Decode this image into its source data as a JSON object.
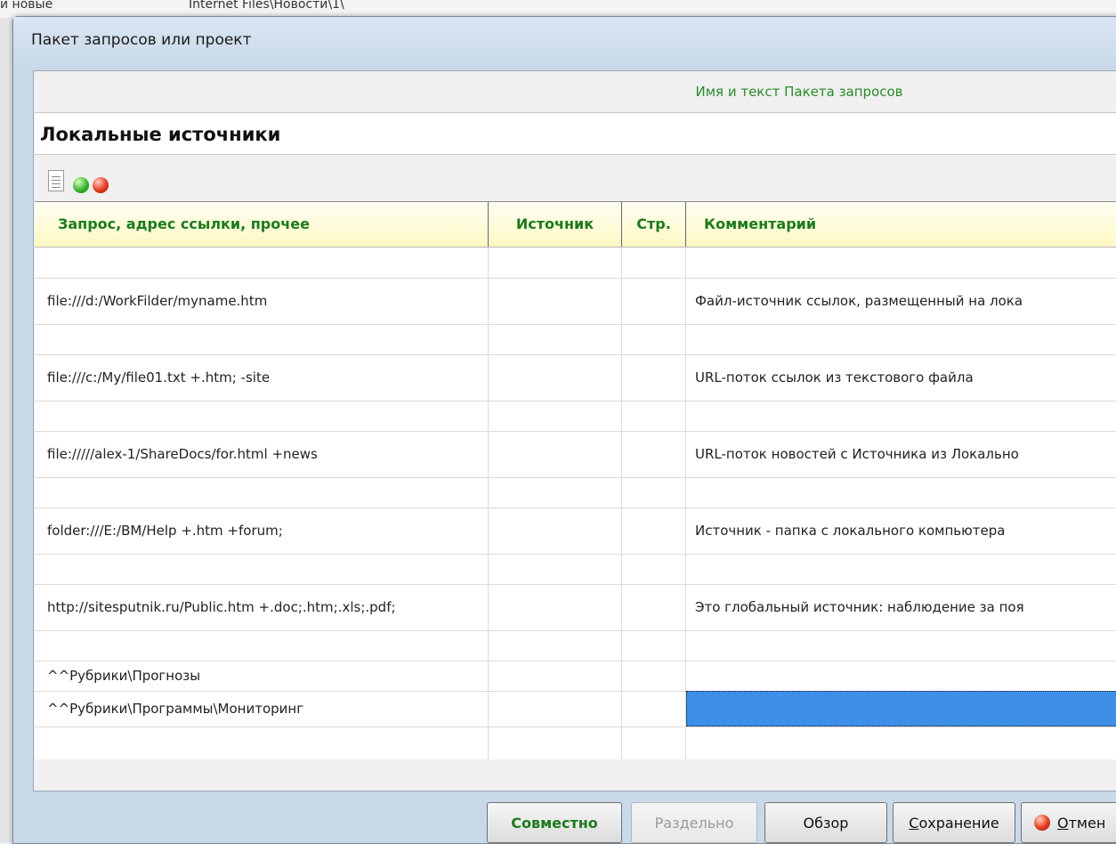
{
  "background": {
    "left_text": "и новые",
    "right_text": "Internet Files\\Новости\\1\\"
  },
  "window": {
    "title": "Пакет запросов или проект"
  },
  "group": {
    "caption": "Имя и текст Пакета запросов"
  },
  "package": {
    "name": "Локальные источники"
  },
  "toolbar": {
    "icons": [
      "document-icon",
      "green-ball-icon",
      "red-ball-icon"
    ]
  },
  "table": {
    "headers": [
      "Запрос, адрес ссылки, прочее",
      "Источник",
      "Стр.",
      "Комментарий"
    ],
    "rows": [
      [
        "",
        "",
        "",
        ""
      ],
      [
        "file:///d:/WorkFilder/myname.htm",
        "",
        "",
        "Файл-источник ссылок, размещенный на лока"
      ],
      [
        "",
        "",
        "",
        ""
      ],
      [
        "file:///c:/My/file01.txt +.htm; -site",
        "",
        "",
        "URL-поток ссылок из текстового файла"
      ],
      [
        "",
        "",
        "",
        ""
      ],
      [
        "file://///alex-1/ShareDocs/for.html +news",
        "",
        "",
        "URL-поток новостей с Источника из Локально"
      ],
      [
        "",
        "",
        "",
        ""
      ],
      [
        "folder:///E:/BM/Help +.htm +forum;",
        "",
        "",
        "Источник - папка с локального компьютера"
      ],
      [
        "",
        "",
        "",
        ""
      ],
      [
        "http://sitesputnik.ru/Public.htm +.doc;.htm;.xls;.pdf;",
        "",
        "",
        "Это глобальный источник: наблюдение за поя"
      ],
      [
        "",
        "",
        "",
        ""
      ],
      [
        "^^Рубрики\\Прогнозы",
        "",
        "",
        ""
      ],
      [
        "^^Рубрики\\Программы\\Мониторинг",
        "",
        "",
        ""
      ],
      [
        "",
        "",
        "",
        ""
      ],
      [
        "",
        "",
        "",
        ""
      ],
      [
        "",
        "",
        "",
        ""
      ]
    ],
    "selected": {
      "row": 12,
      "col": 3,
      "color": "#3d8fe8"
    }
  },
  "buttons": {
    "together": "Совместно",
    "separate": "Раздельно",
    "browse": "Обзор",
    "save_first": "С",
    "save_rest": "охранение",
    "cancel_first": "О",
    "cancel_rest": "тмен"
  },
  "colors": {
    "header_text": "#1c7a1c",
    "header_bg": "#fdf8c4",
    "caption": "#2a8a2a"
  }
}
